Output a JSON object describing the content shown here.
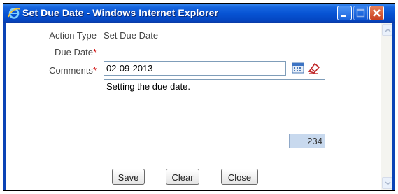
{
  "window": {
    "title": "Set Due Date - Windows Internet Explorer",
    "controls": {
      "minimize": "minimize",
      "maximize": "maximize",
      "close": "close"
    }
  },
  "form": {
    "action_type_label": "Action Type",
    "action_type_value": "Set Due Date",
    "due_date_label": "Due Date",
    "due_date_value": "02-09-2013",
    "comments_label": "Comments",
    "comments_value": "Setting the due date.",
    "required_marker": "*",
    "char_counter": "234"
  },
  "buttons": {
    "save": "Save",
    "clear": "Clear",
    "close": "Close"
  },
  "icons": {
    "calendar": "calendar-icon",
    "clear_date": "eraser-icon"
  },
  "colors": {
    "titlebar": "#0754d4",
    "required": "#d00000",
    "close_button": "#c94020"
  }
}
